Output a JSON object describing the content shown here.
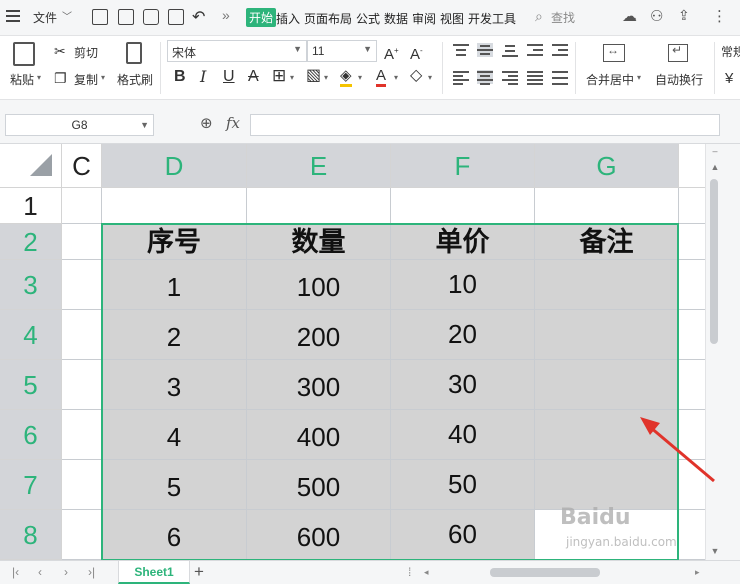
{
  "menubar": {
    "file_label": "文件",
    "tabs": [
      "开始",
      "插入",
      "页面布局",
      "公式",
      "数据",
      "审阅",
      "视图",
      "开发工具"
    ],
    "active_tab": "开始",
    "search_label": "查找"
  },
  "ribbon": {
    "paste_label": "粘贴",
    "cut_label": "剪切",
    "copy_label": "复制",
    "format_painter_label": "格式刷",
    "font_name": "宋体",
    "font_size": "11",
    "merge_label": "合并居中",
    "wrap_label": "自动换行",
    "number_format": "常规",
    "currency_symbol": "¥"
  },
  "formula_bar": {
    "name_box": "G8",
    "fx_label": "fx",
    "formula": ""
  },
  "columns": [
    "C",
    "D",
    "E",
    "F",
    "G"
  ],
  "rows": [
    "1",
    "2",
    "3",
    "4",
    "5",
    "6",
    "7",
    "8"
  ],
  "table": {
    "headers": [
      "序号",
      "数量",
      "单价",
      "备注"
    ],
    "rows": [
      [
        "1",
        "100",
        "10",
        ""
      ],
      [
        "2",
        "200",
        "20",
        ""
      ],
      [
        "3",
        "300",
        "30",
        ""
      ],
      [
        "4",
        "400",
        "40",
        ""
      ],
      [
        "5",
        "500",
        "50",
        ""
      ],
      [
        "6",
        "600",
        "60",
        ""
      ]
    ]
  },
  "sheets": {
    "active": "Sheet1"
  },
  "watermark": {
    "brand": "Baidu",
    "sub": "jingyan.baidu.com"
  },
  "colors": {
    "accent": "#2db47b",
    "selection_fill": "#d3d3d3",
    "arrow": "#e0332a"
  }
}
